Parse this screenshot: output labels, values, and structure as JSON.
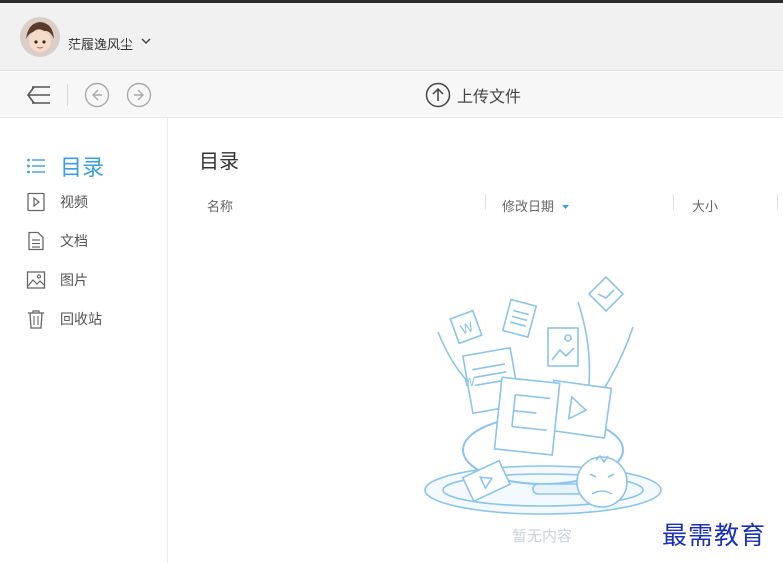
{
  "user": {
    "name": "茫履逸风尘"
  },
  "toolbar": {
    "upload_label": "上传文件"
  },
  "sidebar": {
    "items": [
      {
        "label": "目录",
        "icon": "list-icon",
        "active": true
      },
      {
        "label": "视频",
        "icon": "video-icon",
        "active": false
      },
      {
        "label": "文档",
        "icon": "document-icon",
        "active": false
      },
      {
        "label": "图片",
        "icon": "image-icon",
        "active": false
      },
      {
        "label": "回收站",
        "icon": "trash-icon",
        "active": false
      }
    ]
  },
  "main": {
    "title": "目录",
    "columns": {
      "name": "名称",
      "modified": "修改日期",
      "size": "大小"
    },
    "empty_text": "暂无内容"
  },
  "watermark": "最需教育",
  "colors": {
    "accent": "#3aa0e6",
    "illustration": "#8cc4ec"
  }
}
